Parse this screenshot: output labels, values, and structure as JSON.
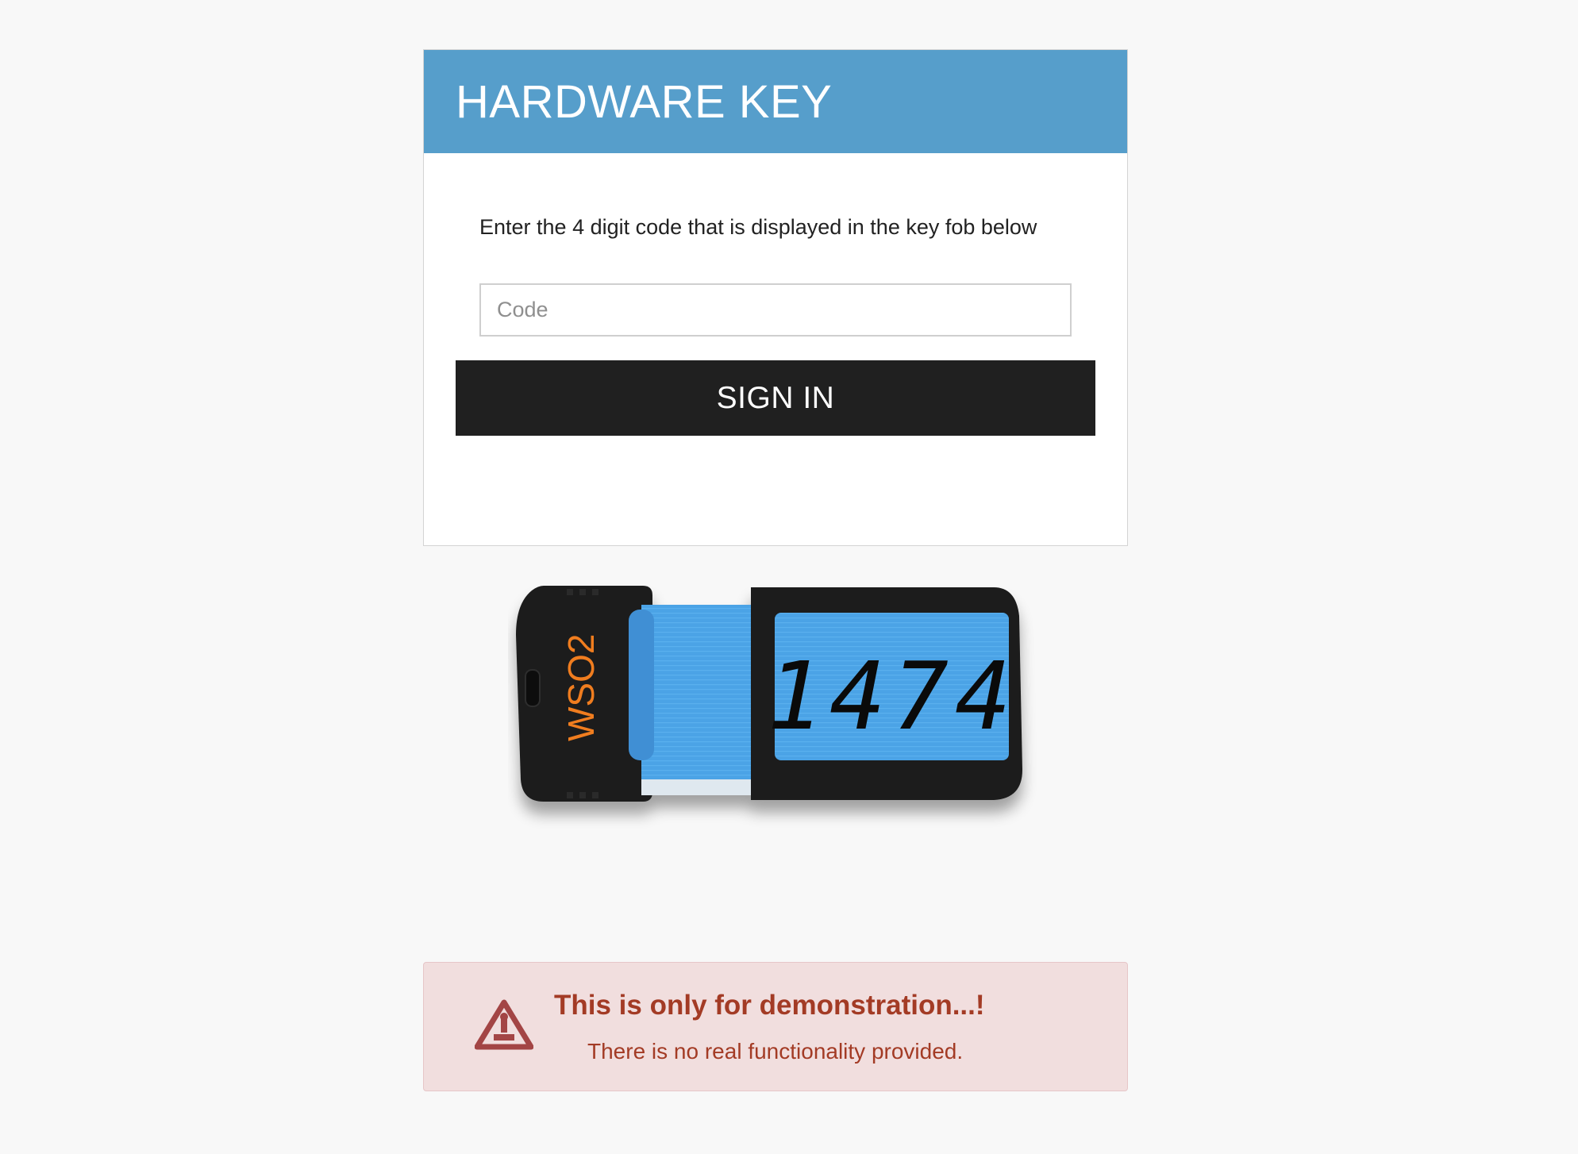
{
  "card": {
    "title": "HARDWARE KEY",
    "instruction": "Enter the 4 digit code that is displayed in the key fob below",
    "code_placeholder": "Code",
    "code_value": "",
    "signin_label": "SIGN IN"
  },
  "fob": {
    "brand": "WSO2",
    "display_code": "1474",
    "body_color": "#1a1a1a",
    "screen_color": "#4ba3e6",
    "brand_color": "#f07d1f"
  },
  "alert": {
    "icon": "warning-icon",
    "title": "This is only for demonstration...!",
    "text": "There is no real functionality provided."
  },
  "colors": {
    "header": "#569ecb",
    "button": "#202020",
    "alert_bg": "#f1dede",
    "alert_text": "#a33b25",
    "page_bg": "#f8f8f8"
  }
}
